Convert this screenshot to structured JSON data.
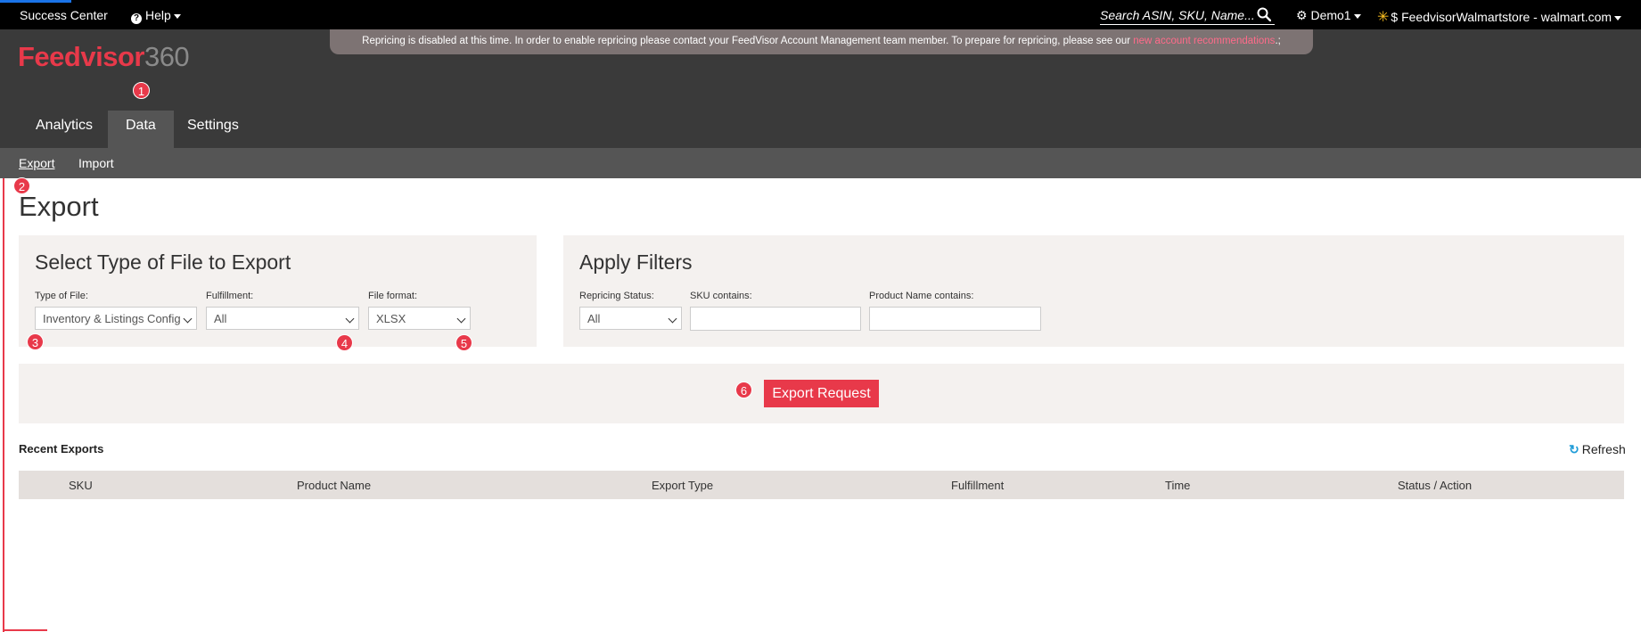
{
  "topbar": {
    "success_center": "Success Center",
    "help": "Help",
    "search_placeholder": "Search ASIN, SKU, Name...",
    "demo_user": "Demo1",
    "store": "FeedvisorWalmartstore - walmart.com",
    "store_prefix": "$"
  },
  "logo": {
    "brand": "Feedvisor",
    "suffix": "360"
  },
  "banner": {
    "text": "Repricing is disabled at this time. In order to enable repricing please contact your FeedVisor Account Management team member. To prepare for repricing, please see our ",
    "link": "new account recommendations",
    "trail": ".;"
  },
  "main_tabs": [
    {
      "label": "Analytics"
    },
    {
      "label": "Data"
    },
    {
      "label": "Settings"
    }
  ],
  "sub_nav": [
    {
      "label": "Export"
    },
    {
      "label": "Import"
    }
  ],
  "badges": [
    "1",
    "2",
    "3",
    "4",
    "5",
    "6"
  ],
  "page": {
    "title": "Export"
  },
  "file_panel": {
    "title": "Select Type of File to Export",
    "type_label": "Type of File:",
    "type_value": "Inventory & Listings Config",
    "fulfillment_label": "Fulfillment:",
    "fulfillment_value": "All",
    "format_label": "File format:",
    "format_value": "XLSX"
  },
  "filters_panel": {
    "title": "Apply Filters",
    "repricing_label": "Repricing Status:",
    "repricing_value": "All",
    "sku_label": "SKU contains:",
    "product_label": "Product Name contains:"
  },
  "export_button": "Export Request",
  "recent": {
    "title": "Recent Exports",
    "refresh": "Refresh",
    "columns": [
      "SKU",
      "Product Name",
      "Export Type",
      "Fulfillment",
      "Time",
      "Status / Action"
    ]
  },
  "colors": {
    "brand_red": "#e8394a",
    "header_dark": "#3a3a3a",
    "panel_bg": "#f4f1ef",
    "refresh_blue": "#1e9bd7"
  }
}
